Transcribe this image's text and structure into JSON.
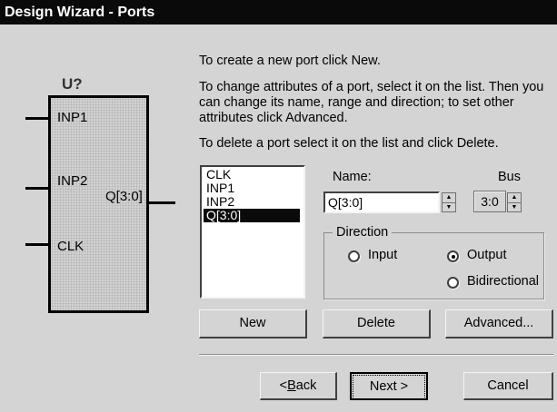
{
  "window": {
    "title": "Design Wizard - Ports"
  },
  "symbol": {
    "ref": "U?",
    "inputs": [
      "INP1",
      "INP2",
      "CLK"
    ],
    "outputs": [
      "Q[3:0]"
    ]
  },
  "instructions": {
    "create": "To create a new port click New.",
    "change": "To change attributes of a port, select it on the list. Then you can change its name, range and direction; to set other attributes click Advanced.",
    "delete": "To delete a port select it on the list and click Delete."
  },
  "ports": {
    "items": [
      "CLK",
      "INP1",
      "INP2",
      "Q[3:0]"
    ],
    "selected_index": 3
  },
  "name_field": {
    "label": "Name:",
    "value": "Q[3:0]"
  },
  "bus_field": {
    "label": "Bus",
    "value": "3:0"
  },
  "direction": {
    "label": "Direction",
    "options": [
      "Input",
      "Output",
      "Bidirectional"
    ],
    "selected": "Output"
  },
  "actions": {
    "new": "New",
    "delete": "Delete",
    "advanced": "Advanced..."
  },
  "nav": {
    "back_mnemonic": "B",
    "back_rest": "ack",
    "back_prefix": "< ",
    "next": "Next >",
    "cancel": "Cancel"
  },
  "colors": {
    "titlebar": "#0a0a0a",
    "dialog": "#d4d4d4",
    "selection": "#0a0a0a"
  }
}
